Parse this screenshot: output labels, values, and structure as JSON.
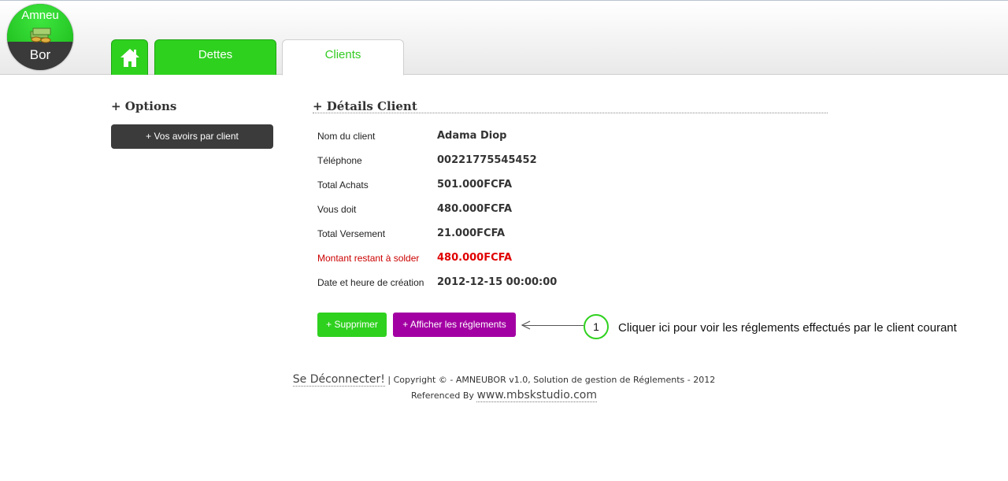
{
  "logo": {
    "line1": "Amneu",
    "line2": "Bor"
  },
  "tabs": [
    {
      "id": "home",
      "icon": "home-icon"
    },
    {
      "id": "dettes",
      "label": "Dettes"
    },
    {
      "id": "clients",
      "label": "Clients",
      "active": true
    }
  ],
  "options": {
    "title": "+ Options",
    "button_label": "+ Vos avoirs par client"
  },
  "details": {
    "title": "+ Détails Client",
    "rows": [
      {
        "label": "Nom du client",
        "value": "Adama Diop"
      },
      {
        "label": "Téléphone",
        "value": "00221775545452"
      },
      {
        "label": "Total Achats",
        "value": "501.000FCFA"
      },
      {
        "label": "Vous doit",
        "value": "480.000FCFA"
      },
      {
        "label": "Total Versement",
        "value": "21.000FCFA"
      },
      {
        "label": "Montant restant à solder",
        "value": "480.000FCFA"
      },
      {
        "label": "Date et heure de création",
        "value": "2012-12-15 00:00:00"
      }
    ]
  },
  "actions": {
    "delete_label": "+ Supprimer",
    "show_payments_label": "+ Afficher les réglements"
  },
  "callout": {
    "number": "1",
    "text": "Cliquer ici pour voir les réglements effectués par le client courant"
  },
  "footer": {
    "logout": "Se Déconnecter!",
    "copyright": " | Copyright © - AMNEUBOR v1.0, Solution de gestion de Réglements - 2012",
    "referenced_by": "Referenced By ",
    "site": "www.mbskstudio.com"
  },
  "colors": {
    "accent_green": "#2fd11f",
    "purple": "#a300a3",
    "alert_red": "#e00000",
    "dark_button": "#3b3b3b"
  }
}
